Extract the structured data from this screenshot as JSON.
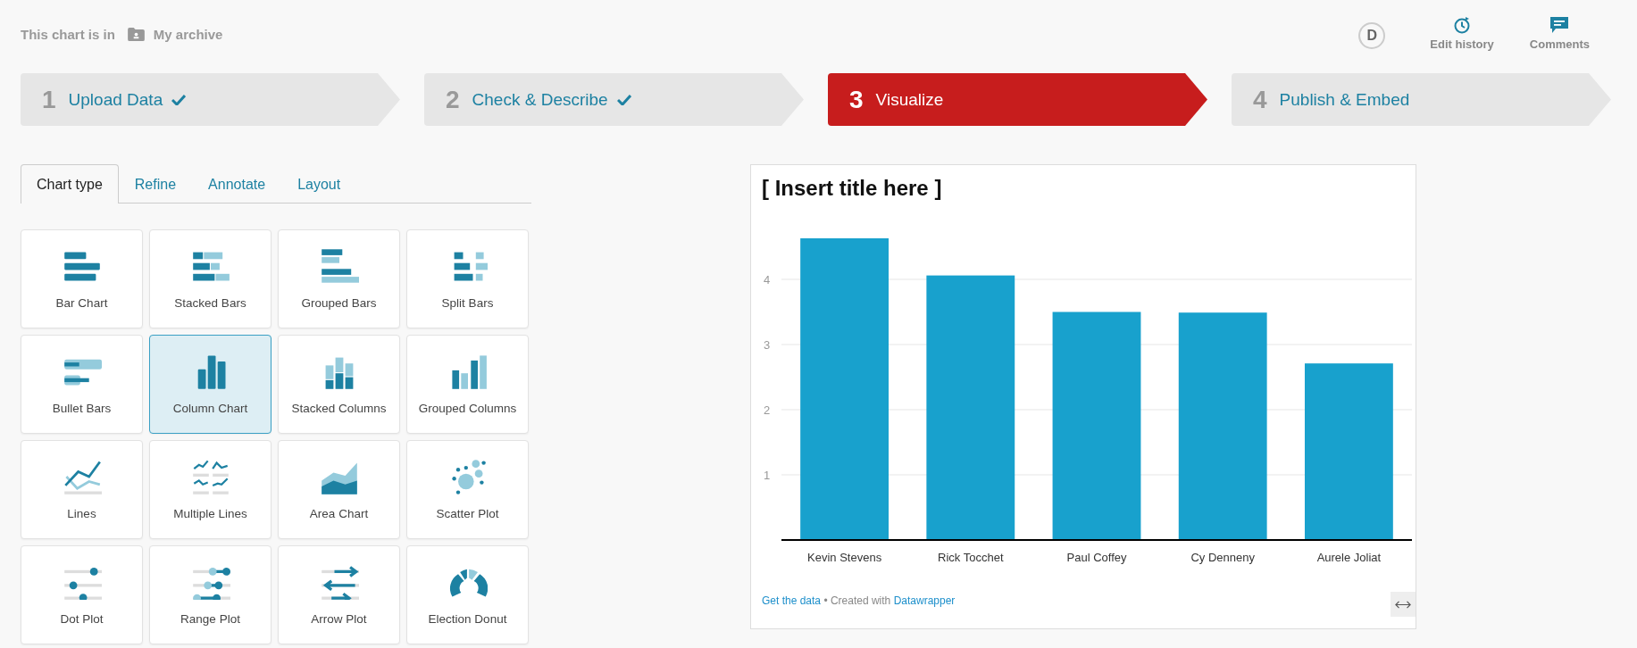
{
  "location": {
    "prefix": "This chart is in",
    "folder": "My archive"
  },
  "user": {
    "initial": "D"
  },
  "actions": [
    {
      "kind": "history",
      "label": "Edit history"
    },
    {
      "kind": "comments",
      "label": "Comments"
    }
  ],
  "steps": [
    {
      "number": "1",
      "label": "Upload Data",
      "done": true,
      "selected": false
    },
    {
      "number": "2",
      "label": "Check & Describe",
      "done": true,
      "selected": false
    },
    {
      "number": "3",
      "label": "Visualize",
      "done": false,
      "selected": true
    },
    {
      "number": "4",
      "label": "Publish & Embed",
      "done": false,
      "selected": false
    }
  ],
  "tabs": [
    {
      "label": "Chart type",
      "selected": true
    },
    {
      "label": "Refine",
      "selected": false
    },
    {
      "label": "Annotate",
      "selected": false
    },
    {
      "label": "Layout",
      "selected": false
    }
  ],
  "chart_types": [
    {
      "kind": "bar",
      "label": "Bar Chart",
      "selected": false
    },
    {
      "kind": "stacked-bars",
      "label": "Stacked Bars",
      "selected": false
    },
    {
      "kind": "grouped-bars",
      "label": "Grouped Bars",
      "selected": false
    },
    {
      "kind": "split-bars",
      "label": "Split Bars",
      "selected": false
    },
    {
      "kind": "bullet-bars",
      "label": "Bullet Bars",
      "selected": false
    },
    {
      "kind": "column",
      "label": "Column Chart",
      "selected": true
    },
    {
      "kind": "stacked-columns",
      "label": "Stacked Columns",
      "selected": false
    },
    {
      "kind": "grouped-columns",
      "label": "Grouped Columns",
      "selected": false
    },
    {
      "kind": "lines",
      "label": "Lines",
      "selected": false
    },
    {
      "kind": "multiple-lines",
      "label": "Multiple Lines",
      "selected": false
    },
    {
      "kind": "area",
      "label": "Area Chart",
      "selected": false
    },
    {
      "kind": "scatter",
      "label": "Scatter Plot",
      "selected": false
    },
    {
      "kind": "dot",
      "label": "Dot Plot",
      "selected": false
    },
    {
      "kind": "range",
      "label": "Range Plot",
      "selected": false
    },
    {
      "kind": "arrow",
      "label": "Arrow Plot",
      "selected": false
    },
    {
      "kind": "donut",
      "label": "Election Donut",
      "selected": false
    }
  ],
  "preview": {
    "title": "[ Insert title here ]",
    "chart_data": {
      "type": "bar",
      "categories": [
        "Kevin Stevens",
        "Rick Tocchet",
        "Paul Coffey",
        "Cy Denneny",
        "Aurele Joliat"
      ],
      "values": [
        4.63,
        4.06,
        3.5,
        3.49,
        2.71
      ],
      "grid": true,
      "ylim": [
        0,
        4.63
      ],
      "yticks": [
        1,
        2,
        3,
        4
      ]
    },
    "footer": {
      "data_link": "Get the data",
      "created": "• Created with",
      "brand_link": "Datawrapper"
    }
  }
}
